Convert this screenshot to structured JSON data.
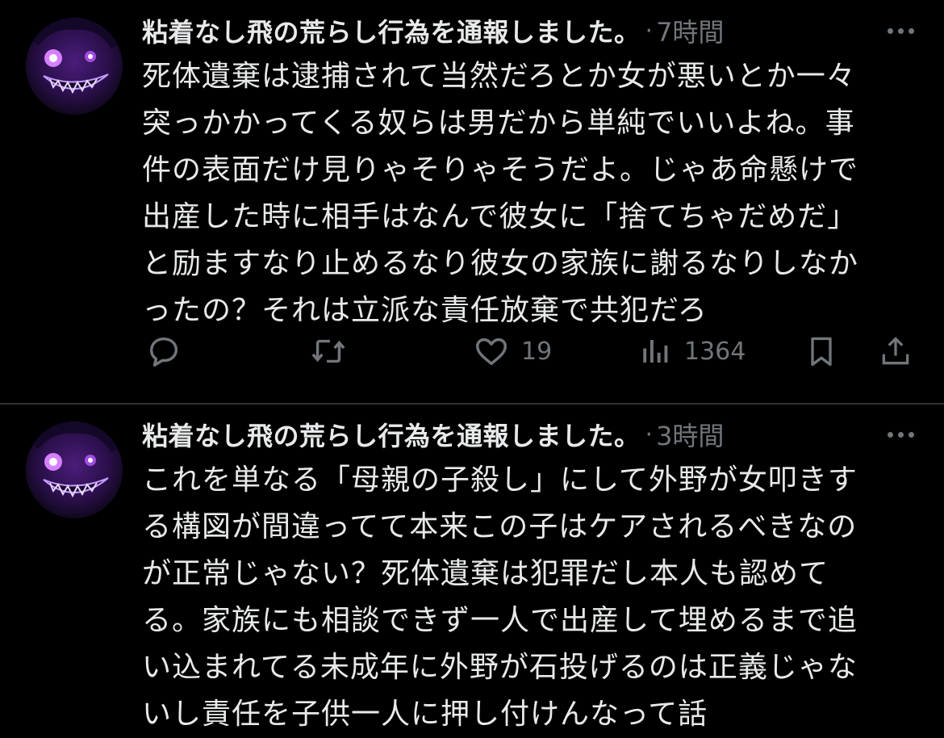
{
  "tweets": [
    {
      "author": "粘着なし飛の荒らし行為を通報しました。",
      "separator": "·",
      "time": "7時間",
      "lines": [
        "死体遺棄は逮捕されて当然だろとか女が悪いとか一々",
        "突っかかってくる奴らは男だから単純でいいよね。事",
        "件の表面だけ見りゃそりゃそうだよ。じゃあ命懸けで",
        "出産した時に相手はなんで彼女に「捨てちゃだめだ」",
        "と励ますなり止めるなり彼女の家族に謝るなりしなか",
        "ったの？それは立派な責任放棄で共犯だろ"
      ],
      "actions": {
        "reply_icon": "reply-icon",
        "retweet_icon": "retweet-icon",
        "like_icon": "heart-icon",
        "likes": "19",
        "views_icon": "views-icon",
        "views": "1364",
        "bookmark_icon": "bookmark-icon",
        "share_icon": "share-icon"
      }
    },
    {
      "author": "粘着なし飛の荒らし行為を通報しました。",
      "separator": "·",
      "time": "3時間",
      "lines": [
        "これを単なる「母親の子殺し」にして外野が女叩きす",
        "る構図が間違ってて本来この子はケアされるべきなの",
        "が正常じゃない？死体遺棄は犯罪だし本人も認めて",
        "る。家族にも相談できず一人で出産して埋めるまで追",
        "い込まれてる未成年に外野が石投げるのは正義じゃな",
        "いし責任を子供一人に押し付けんなって話"
      ]
    }
  ],
  "colors": {
    "background": "#000000",
    "text": "#e7e9ea",
    "muted": "#71767b",
    "divider": "#2f3336",
    "avatar_accent": "#b14cff"
  }
}
